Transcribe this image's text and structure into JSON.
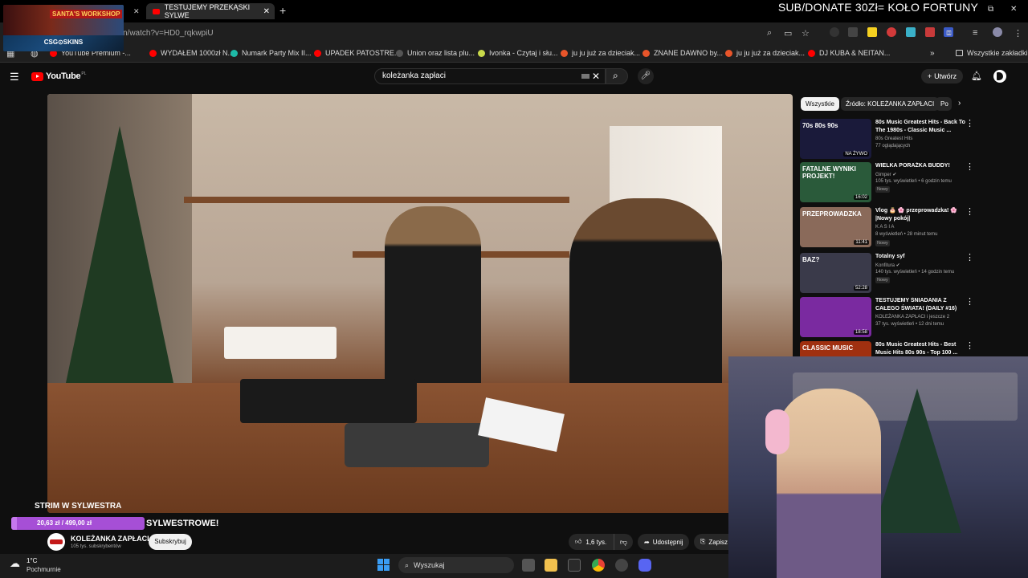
{
  "browser": {
    "stream_logo_art_text": "SANTA'S WORKSHOP",
    "stream_logo_caption": "CSG⊙SKINS",
    "active_tab_title": "TESTUJEMY PRZEKĄSKI SYLWE",
    "tab_close": "✕",
    "new_tab": "+",
    "url": "n/watch?v=HD0_rqkwpiU",
    "bookmarks": [
      {
        "label": "YouTube Premium -...",
        "color": "#ff0000"
      },
      {
        "label": "WYDAŁEM 1000zł N...",
        "color": "#ff0000"
      },
      {
        "label": "Numark Party Mix II...",
        "color": "#1db9a6"
      },
      {
        "label": "UPADEK PATOSTRE...",
        "color": "#ff0000"
      },
      {
        "label": "Union oraz lista plu...",
        "color": "#555555"
      },
      {
        "label": "Ivonka - Czytaj i słu...",
        "color": "#c8d94a"
      },
      {
        "label": "ju ju już za dzieciak...",
        "color": "#e8552a"
      },
      {
        "label": "ZNANE DAWNO by...",
        "color": "#e8552a"
      },
      {
        "label": "ju ju już za dzieciak...",
        "color": "#e8552a"
      },
      {
        "label": "DJ KUBA & NEITAN...",
        "color": "#ff0000"
      }
    ],
    "all_bookmarks": "Wszystkie zakładki"
  },
  "stream_overlay": {
    "donate_banner": "SUB/DONATE 30Zł= KOŁO FORTUNY",
    "strim_label": "STRIM W SYLWESTRA",
    "goal_text": "20,63 zł / 499,00 zł",
    "goal_fraction": 0.04
  },
  "youtube": {
    "logo_text": "YouTube",
    "logo_country": "PL",
    "search_query": "koleżanka zapłaci",
    "create_label": "Utwórz",
    "video": {
      "title": "SYLWESTROWE!",
      "channel": "KOLEŻANKA ZAPŁACI",
      "subscribers": "105 tys. subskrybentów",
      "subscribe_label": "Subskrybuj",
      "likes": "1,6 tys.",
      "share_label": "Udostępnij",
      "save_label": "Zapisz"
    },
    "chips": [
      "Wszystkie",
      "Źródło: KOLEŻANKA ZAPŁACI",
      "Po"
    ],
    "recommendations": [
      {
        "title": "80s Music Greatest Hits - Back To The 1980s - Classic Music ...",
        "channel": "80s Greatest Hits",
        "meta": "77 oglądających",
        "thumb_text": "70s 80s 90s",
        "duration": "NA ŻYWO",
        "thumb_color": "#1a1a3a",
        "badge": ""
      },
      {
        "title": "WIELKA PORAŻKA BUDDY!",
        "channel": "Gimper ✔",
        "meta": "105 tys. wyświetleń • 6 godzin temu",
        "thumb_text": "FATALNE WYNIKI PROJEKT!",
        "duration": "16:02",
        "thumb_color": "#2a5a3a",
        "badge": "Nowy"
      },
      {
        "title": "Vlog 🎂 🌸 przeprowadzka! 🌸 |Nowy pokój|",
        "channel": "K A S I A",
        "meta": "8 wyświetleń • 28 minut temu",
        "thumb_text": "PRZEPROWADZKA",
        "duration": "11:41",
        "thumb_color": "#8a6a5a",
        "badge": "Nowy"
      },
      {
        "title": "Totalny syf",
        "channel": "Konfitura ✔",
        "meta": "140 tys. wyświetleń • 14 godzin temu",
        "thumb_text": "BAZ?",
        "duration": "52:28",
        "thumb_color": "#3a3a4a",
        "badge": "Nowy"
      },
      {
        "title": "TESTUJEMY ŚNIADANIA Z CAŁEGO ŚWIATA! (DAILY #16)",
        "channel": "KOLEŻANKA ZAPŁACI i jeszcze 2",
        "meta": "37 tys. wyświetleń • 12 dni temu",
        "thumb_text": "",
        "duration": "18:58",
        "thumb_color": "#7a2aa0",
        "badge": ""
      },
      {
        "title": "80s Music Greatest Hits - Best Music Hits 80s 90s - Top 100 ...",
        "channel": "",
        "meta": "",
        "thumb_text": "CLASSIC MUSIC",
        "duration": "",
        "thumb_color": "#a03010",
        "badge": ""
      }
    ]
  },
  "taskbar": {
    "weather_temp": "1°C",
    "weather_desc": "Pochmurnie",
    "search_placeholder": "Wyszukaj"
  }
}
